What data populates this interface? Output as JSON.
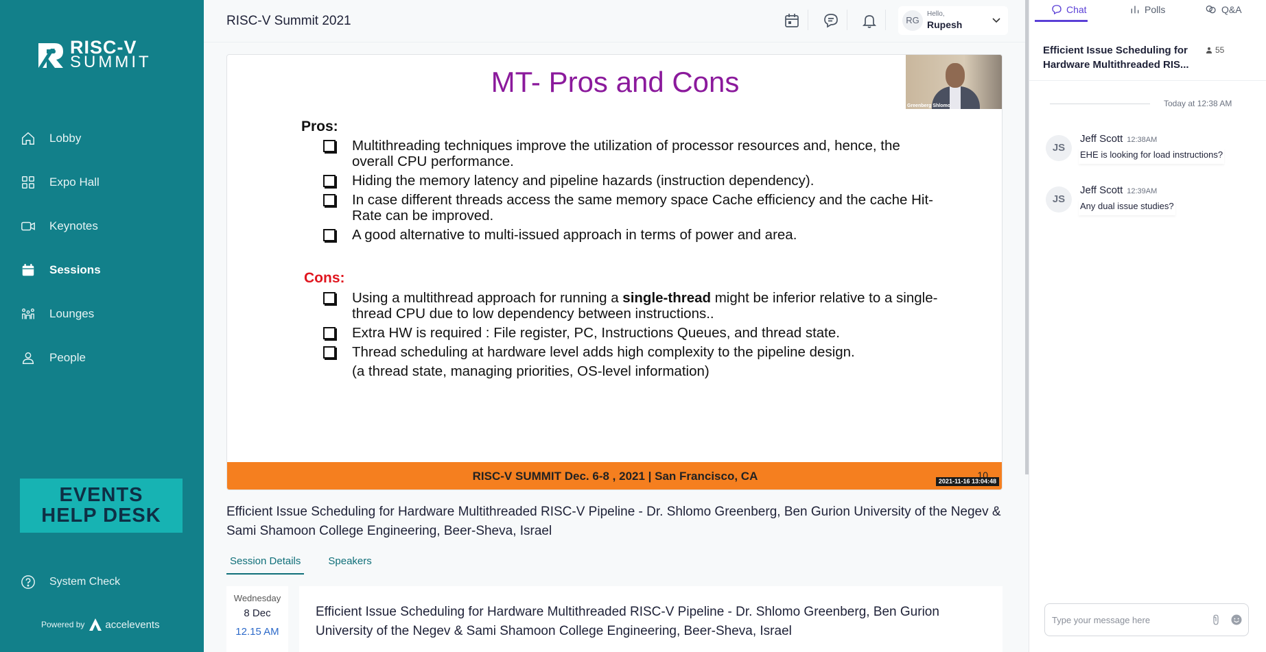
{
  "sidebar": {
    "logo": {
      "line1": "RISC-V",
      "line2": "SUMMIT"
    },
    "nav": [
      {
        "label": "Lobby",
        "icon": "home-icon"
      },
      {
        "label": "Expo Hall",
        "icon": "grid-icon"
      },
      {
        "label": "Keynotes",
        "icon": "video-icon"
      },
      {
        "label": "Sessions",
        "icon": "calendar-icon",
        "active": true
      },
      {
        "label": "Lounges",
        "icon": "lounge-icon"
      },
      {
        "label": "People",
        "icon": "person-icon"
      }
    ],
    "helpdesk": {
      "line1": "EVENTS",
      "line2": "HELP DESK"
    },
    "system_check": "System Check",
    "powered_by": "Powered by",
    "brand": "accelevents"
  },
  "header": {
    "event_title": "RISC-V Summit 2021",
    "user": {
      "initials": "RG",
      "hello": "Hello,",
      "name": "Rupesh"
    }
  },
  "slide": {
    "title": "MT- Pros and Cons",
    "pros_label": "Pros:",
    "pros": [
      "Multithreading techniques improve the utilization of processor resources and, hence, the overall CPU performance.",
      "Hiding the memory latency and pipeline hazards (instruction dependency).",
      "In case different threads access the same memory space Cache efficiency and the cache Hit-Rate can be improved.",
      "A good alternative to multi-issued approach in terms of power and area."
    ],
    "cons_label": "Cons:",
    "cons1_pre": "Using a multithread approach for running a ",
    "cons1_bold": "single-thread",
    "cons1_post": " might be inferior relative to a single-thread CPU due to low dependency between instructions..",
    "cons": [
      "Extra HW is required : File register, PC, Instructions Queues, and thread state.",
      "Thread scheduling at hardware level adds high complexity to the pipeline design."
    ],
    "cons_note": "(a thread state, managing priorities, OS-level information)",
    "footer": "RISC-V SUMMIT  Dec. 6-8 , 2021 | San Francisco, CA",
    "page_number": "10",
    "timestamp": "2021-11-16  13:04:48",
    "speaker_cam_name": "Greenberg Shlomo"
  },
  "session": {
    "title": "Efficient Issue Scheduling for Hardware Multithreaded RISC-V Pipeline - Dr. Shlomo Greenberg, Ben Gurion University of the Negev & Sami Shamoon College Engineering, Beer-Sheva, Israel",
    "tabs": [
      "Session Details",
      "Speakers"
    ],
    "date": {
      "weekday": "Wednesday",
      "day_month": "8 Dec",
      "time": "12.15 AM"
    },
    "detail_title": "Efficient Issue Scheduling for Hardware Multithreaded RISC-V Pipeline - Dr. Shlomo Greenberg, Ben Gurion University of the Negev & Sami Shamoon College Engineering, Beer-Sheva, Israel"
  },
  "chat_panel": {
    "tabs": [
      "Chat",
      "Polls",
      "Q&A"
    ],
    "title": "Efficient Issue Scheduling for Hardware Multithreaded RIS...",
    "attendee_count": "55",
    "day_separator": "Today at 12:38 AM",
    "messages": [
      {
        "initials": "JS",
        "name": "Jeff Scott",
        "time": "12:38AM",
        "text": "EHE is looking for load instructions?"
      },
      {
        "initials": "JS",
        "name": "Jeff Scott",
        "time": "12:39AM",
        "text": "Any dual issue studies?"
      }
    ],
    "input_placeholder": "Type your message here"
  },
  "colors": {
    "sidebar": "#12808a",
    "accent": "#5a3fd6",
    "slide_title": "#8b1a9c",
    "slide_footer": "#f57f1f",
    "cons": "#e0161f",
    "helpdesk": "#17b3b3"
  }
}
